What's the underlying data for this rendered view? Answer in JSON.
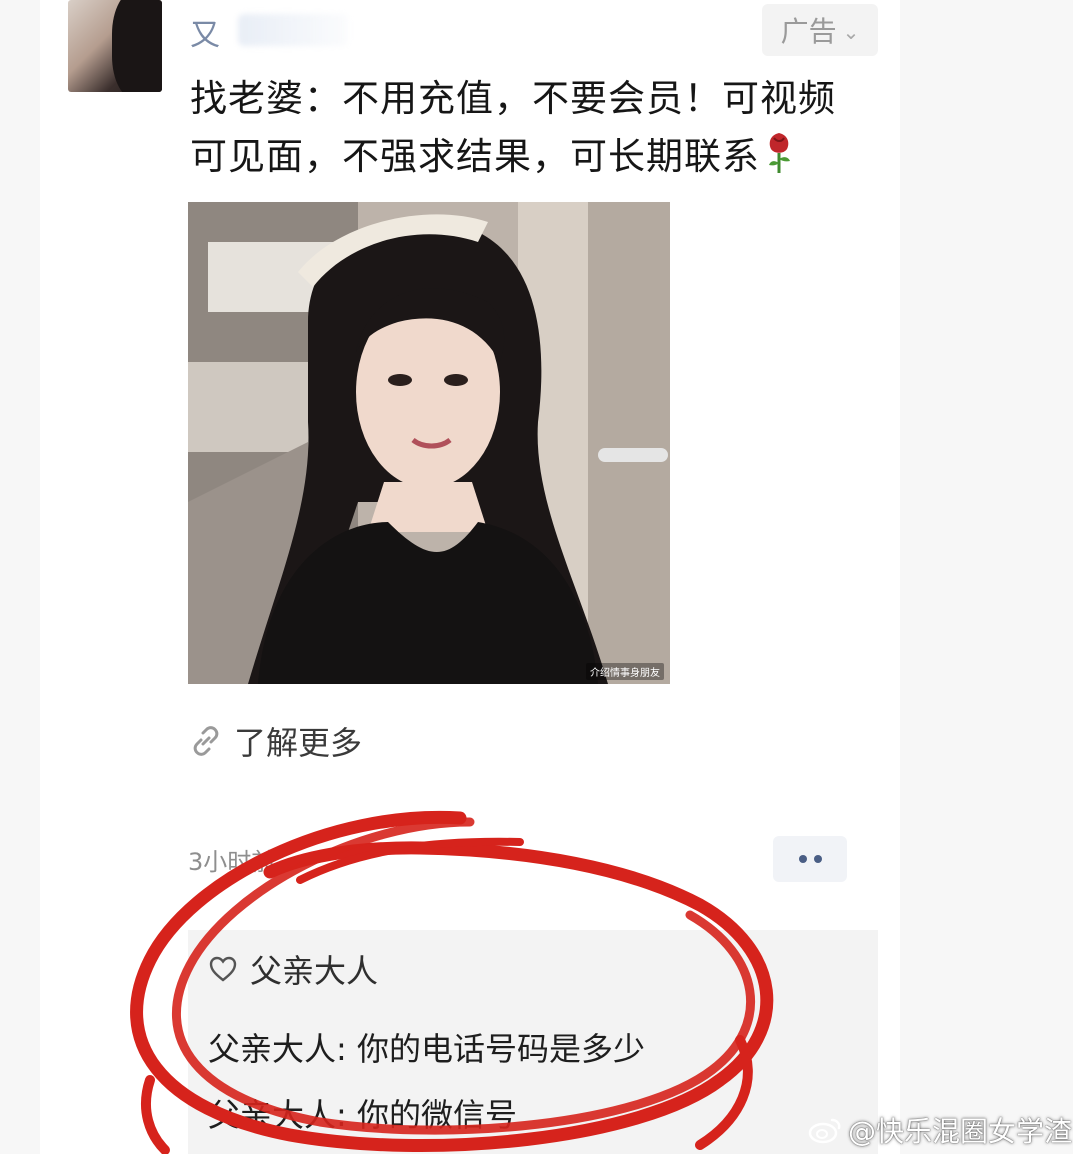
{
  "post": {
    "author_name": "又",
    "ad_label": "广告",
    "text_line1": "找老婆：不用充值，不要会员！可视频",
    "text_line2": "可见面，不强求结果，可长期联系",
    "photo_watermark": "介绍情事身朋友",
    "learn_more": "了解更多",
    "meta": "3小时前"
  },
  "comments": {
    "likes": "父亲大人",
    "items": [
      {
        "author": "父亲大人",
        "sep": ": ",
        "text": "你的电话号码是多少"
      },
      {
        "author": "父亲大人",
        "sep": ": ",
        "text": "你的微信号"
      }
    ]
  },
  "source_watermark": "@快乐混圈女学渣",
  "colors": {
    "highlight_circle": "#d6231c",
    "author_link": "#7a8aa6",
    "meta": "#8e8e8e"
  }
}
